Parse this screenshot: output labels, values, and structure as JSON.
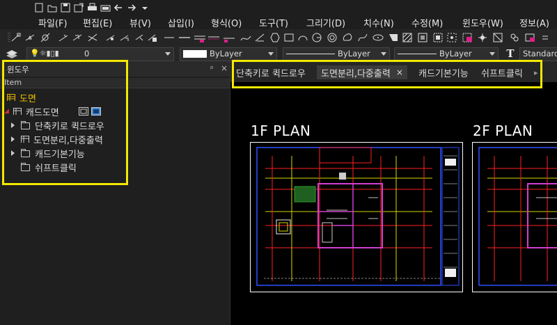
{
  "menu": {
    "items": [
      "파일(F)",
      "편집(E)",
      "뷰(V)",
      "삽입(I)",
      "형식(O)",
      "도구(T)",
      "그리기(D)",
      "치수(N)",
      "수정(M)",
      "윈도우(W)",
      "정보(A)"
    ]
  },
  "properties_bar": {
    "layer_value": "0",
    "color_value": "ByLayer",
    "linetype_value": "ByLayer",
    "lineweight_value": "ByLayer",
    "text_style_value": "Standard"
  },
  "panel": {
    "title": "윈도우",
    "pin_glyph": "ᵖ",
    "close_glyph": "×",
    "column_header": "Item",
    "tree": {
      "root_label": "도면",
      "drawing_label": "캐드도면",
      "children": [
        "단축키로 퀵드로우",
        "도면분리,다중출력",
        "캐드기본기능",
        "쉬프트클릭"
      ]
    }
  },
  "tabs": {
    "items": [
      "단축키로 퀵드로우",
      "도면분리,다중출력",
      "캐드기본기능",
      "쉬프트클릭"
    ],
    "active_index": 1,
    "close_glyph": "×",
    "overflow_glyph": "▸"
  },
  "drawing": {
    "plan1_title": "1F PLAN",
    "plan2_title": "2F PLAN"
  },
  "colors": {
    "highlight": "#f4e800",
    "root_label": "#f0c000",
    "frame_blue": "#3050ff",
    "grid_red": "#ff2020",
    "wall_magenta": "#d040d0"
  }
}
